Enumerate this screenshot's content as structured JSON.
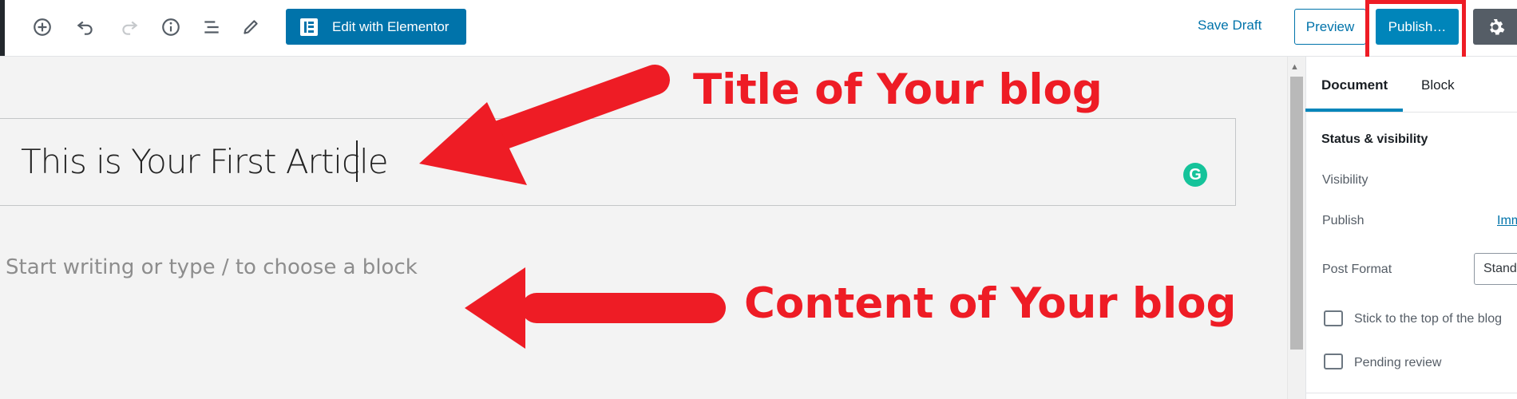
{
  "toolbar": {
    "icons": [
      "add-block-icon",
      "undo-icon",
      "redo-icon",
      "info-icon",
      "outline-icon",
      "edit-tools-icon"
    ],
    "elementor_label": "Edit with Elementor",
    "save_draft_label": "Save Draft",
    "preview_label": "Preview",
    "publish_label": "Publish…",
    "settings_icon": "gear-icon"
  },
  "editor": {
    "title_value": "This is Your First Article",
    "content_placeholder": "Start writing or type / to choose a block",
    "grammarly_letter": "G"
  },
  "annotations": {
    "title_note": "Title of Your blog",
    "content_note": "Content of Your blog",
    "color": "#ee1c25"
  },
  "sidebar": {
    "tabs": [
      {
        "label": "Document",
        "active": true
      },
      {
        "label": "Block",
        "active": false
      }
    ],
    "section_title": "Status & visibility",
    "rows": {
      "visibility_label": "Visibility",
      "publish_label": "Publish",
      "publish_value": "Imm",
      "post_format_label": "Post Format",
      "post_format_value": "Standard"
    },
    "checkboxes": [
      {
        "label": "Stick to the top of the blog",
        "checked": false
      },
      {
        "label": "Pending review",
        "checked": false
      }
    ]
  },
  "colors": {
    "accent": "#0073aa",
    "publish": "#0085ba",
    "highlight": "#ee1c25"
  }
}
